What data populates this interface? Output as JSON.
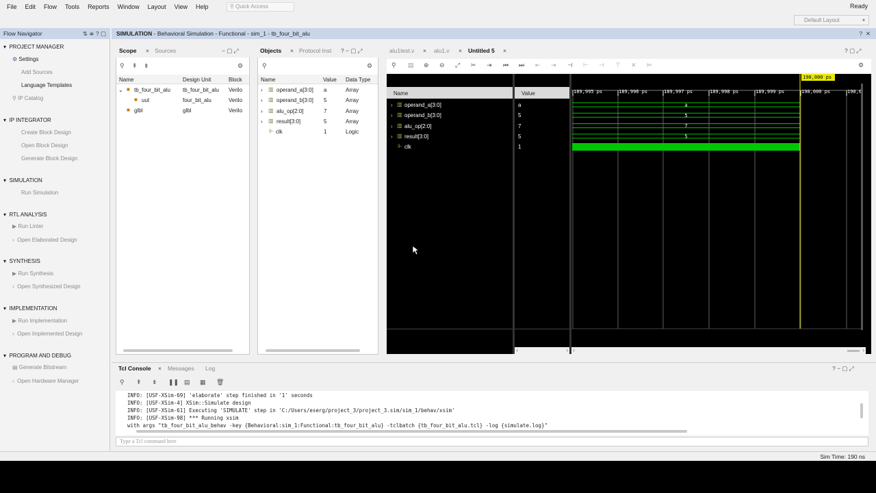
{
  "menu": [
    "File",
    "Edit",
    "Flow",
    "Tools",
    "Reports",
    "Window",
    "Layout",
    "View",
    "Help"
  ],
  "quick_access": "Quick Access",
  "ready": "Ready",
  "layout": "Default Layout",
  "nav": {
    "title": "Flow Navigator",
    "sections": {
      "pm": "PROJECT MANAGER",
      "ipi": "IP INTEGRATOR",
      "sim": "SIMULATION",
      "rtl": "RTL ANALYSIS",
      "syn": "SYNTHESIS",
      "impl": "IMPLEMENTATION",
      "pd": "PROGRAM AND DEBUG"
    },
    "items": {
      "settings": "Settings",
      "add_sources": "Add Sources",
      "lang": "Language Templates",
      "ip_catalog": "IP Catalog",
      "create_bd": "Create Block Design",
      "open_bd": "Open Block Design",
      "gen_bd": "Generate Block Design",
      "run_sim": "Run Simulation",
      "run_linter": "Run Linter",
      "open_elab": "Open Elaborated Design",
      "run_syn": "Run Synthesis",
      "open_syn": "Open Synthesized Design",
      "run_impl": "Run Implementation",
      "open_impl": "Open Implemented Design",
      "gen_bit": "Generate Bitstream",
      "open_hw": "Open Hardware Manager"
    }
  },
  "header": {
    "prefix": "SIMULATION",
    "rest": " - Behavioral Simulation - Functional - sim_1 - tb_four_bit_alu"
  },
  "scope": {
    "tabs": [
      "Scope",
      "Sources"
    ],
    "cols": [
      "Name",
      "Design Unit",
      "Block"
    ],
    "rows": [
      [
        "tb_four_bit_alu",
        "tb_four_bit_alu",
        "Verilo"
      ],
      [
        "uut",
        "four_bit_alu",
        "Verilo"
      ],
      [
        "glbl",
        "glbl",
        "Verilo"
      ]
    ]
  },
  "objects": {
    "tabs": [
      "Objects",
      "Protocol Inst"
    ],
    "cols": [
      "Name",
      "Value",
      "Data Type"
    ],
    "rows": [
      [
        "operand_a[3:0]",
        "a",
        "Array"
      ],
      [
        "operand_b[3:0]",
        "5",
        "Array"
      ],
      [
        "alu_op[2:0]",
        "7",
        "Array"
      ],
      [
        "result[3:0]",
        "5",
        "Array"
      ],
      [
        "clk",
        "1",
        "Logic"
      ]
    ]
  },
  "wave": {
    "tabs": [
      "alu1test.v",
      "alu1.v",
      "Untitled 5"
    ],
    "cols": [
      "Name",
      "Value"
    ],
    "cursor": "190,000 ps",
    "ticks": [
      "189,995 ps",
      "189,996 ps",
      "189,997 ps",
      "189,998 ps",
      "189,999 ps",
      "190,000 ps",
      "190,0"
    ],
    "signals": [
      [
        "operand_a[3:0]",
        "a"
      ],
      [
        "operand_b[3:0]",
        "5"
      ],
      [
        "alu_op[2:0]",
        "7"
      ],
      [
        "result[3:0]",
        "5"
      ],
      [
        "clk",
        "1"
      ]
    ],
    "bus_values": [
      "a",
      "5",
      "7",
      "5"
    ]
  },
  "console": {
    "tabs": [
      "Tcl Console",
      "Messages",
      "Log"
    ],
    "lines": [
      "INFO: [USF-XSim-69] 'elaborate' step finished in '1' seconds",
      "INFO: [USF-XSim-4] XSim::Simulate design",
      "INFO: [USF-XSim-61] Executing 'SIMULATE' step in 'C:/Users/eserg/project_3/project_3.sim/sim_1/behav/xsim'",
      "INFO: [USF-XSim-98] *** Running xsim",
      "   with args \"tb_four_bit_alu_behav -key {Behavioral:sim_1:Functional:tb_four_bit_alu} -tclbatch {tb_four_bit_alu.tcl} -log {simulate.log}\""
    ],
    "placeholder": "Type a Tcl command here"
  },
  "status": "Sim Time: 190 ns",
  "colors": {
    "green": "#00c800",
    "cursor": "#e8e800",
    "header": "#c9d6e8"
  }
}
